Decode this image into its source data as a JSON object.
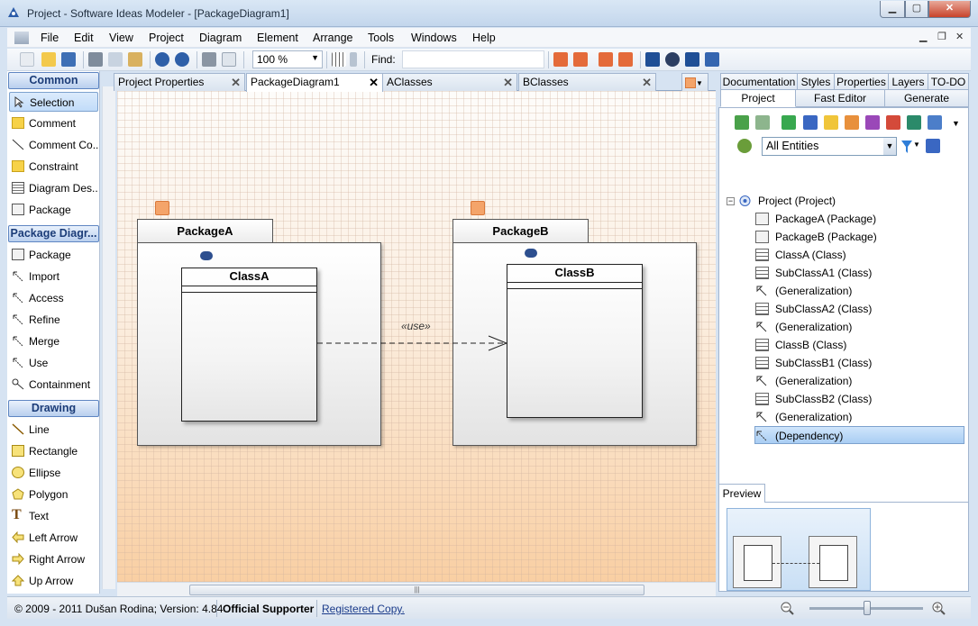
{
  "window": {
    "title": "Project - Software Ideas Modeler - [PackageDiagram1]"
  },
  "menu": [
    {
      "label": "File"
    },
    {
      "label": "Edit"
    },
    {
      "label": "View"
    },
    {
      "label": "Project"
    },
    {
      "label": "Diagram"
    },
    {
      "label": "Element"
    },
    {
      "label": "Arrange"
    },
    {
      "label": "Tools"
    },
    {
      "label": "Windows"
    },
    {
      "label": "Help"
    }
  ],
  "toolbar": {
    "zoom": "100 %",
    "find_label": "Find:",
    "find_value": ""
  },
  "toolbox": {
    "groups": [
      {
        "title": "Common",
        "items": [
          "Selection",
          "Comment",
          "Comment Co...",
          "Constraint",
          "Diagram Des...",
          "Package"
        ]
      },
      {
        "title": "Package Diagr...",
        "items": [
          "Package",
          "Import",
          "Access",
          "Refine",
          "Merge",
          "Use",
          "Containment"
        ]
      },
      {
        "title": "Drawing",
        "items": [
          "Line",
          "Rectangle",
          "Ellipse",
          "Polygon",
          "Text",
          "Left Arrow",
          "Right Arrow",
          "Up Arrow"
        ]
      }
    ],
    "selected": "Selection"
  },
  "doc_tabs": [
    {
      "label": "Project Properties",
      "active": false
    },
    {
      "label": "PackageDiagram1",
      "active": true
    },
    {
      "label": "AClasses",
      "active": false
    },
    {
      "label": "BClasses",
      "active": false
    }
  ],
  "diagram": {
    "packages": [
      {
        "name": "PackageA",
        "class": "ClassA"
      },
      {
        "name": "PackageB",
        "class": "ClassB"
      }
    ],
    "dependency_label": "«use»"
  },
  "right_panel": {
    "top_tabs": [
      "Documentation",
      "Styles",
      "Properties",
      "Layers",
      "TO-DO"
    ],
    "sub_tabs": [
      "Project",
      "Fast Editor",
      "Generate"
    ],
    "active_sub_tab": "Project",
    "filter": "All Entities",
    "tree_root": "Project (Project)",
    "tree_items": [
      {
        "label": "PackageA (Package)",
        "icon": "package-icon"
      },
      {
        "label": "PackageB (Package)",
        "icon": "package-icon"
      },
      {
        "label": "ClassA (Class)",
        "icon": "class-icon"
      },
      {
        "label": "SubClassA1 (Class)",
        "icon": "class-icon"
      },
      {
        "label": "(Generalization)",
        "icon": "generalization-icon"
      },
      {
        "label": "SubClassA2 (Class)",
        "icon": "class-icon"
      },
      {
        "label": "(Generalization)",
        "icon": "generalization-icon"
      },
      {
        "label": "ClassB (Class)",
        "icon": "class-icon"
      },
      {
        "label": "SubClassB1 (Class)",
        "icon": "class-icon"
      },
      {
        "label": "(Generalization)",
        "icon": "generalization-icon"
      },
      {
        "label": "SubClassB2 (Class)",
        "icon": "class-icon"
      },
      {
        "label": "(Generalization)",
        "icon": "generalization-icon"
      },
      {
        "label": "(Dependency)",
        "icon": "dependency-icon",
        "selected": true
      }
    ],
    "preview_tab": "Preview"
  },
  "status": {
    "copyright": "© 2009 - 2011 Dušan Rodina; Version: 4.84",
    "supporter": "Official Supporter",
    "registered": "Registered Copy."
  },
  "colors": {
    "accent": "#3399ff",
    "canvas_gradient_end": "#f9cfa3",
    "header_blue": "#1b3c78"
  }
}
